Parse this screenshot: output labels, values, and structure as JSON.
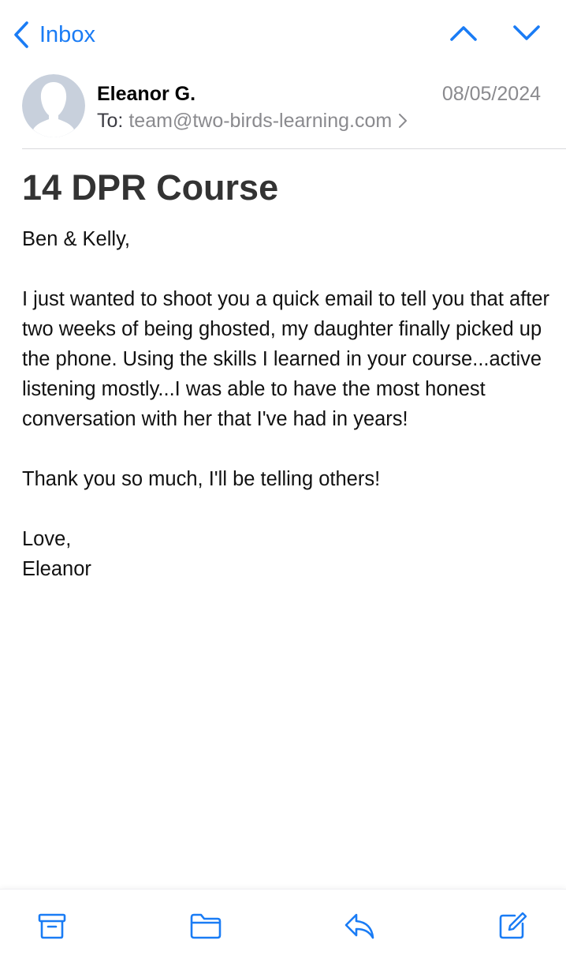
{
  "nav": {
    "back_label": "Inbox",
    "back_icon": "chevron-left-icon",
    "prev_icon": "chevron-up-icon",
    "next_icon": "chevron-down-icon"
  },
  "header": {
    "sender": "Eleanor G.",
    "date": "08/05/2024",
    "to_label": "To:",
    "to_address": "team@two-birds-learning.com",
    "avatar_icon": "person-silhouette-icon"
  },
  "message": {
    "subject": "14 DPR Course",
    "greeting": "Ben & Kelly,",
    "paragraph_1": "I just wanted to shoot you a quick email to tell you that after two weeks of being ghosted, my daughter finally picked up the phone. Using the skills I learned in your course...active listening mostly...I was able to have the most honest conversation with her that I've had in years!",
    "paragraph_2": "Thank you so much, I'll be telling others!",
    "closing": "Love,",
    "signature": "Eleanor"
  },
  "toolbar": {
    "icons": [
      "archive-icon",
      "folder-icon",
      "reply-icon",
      "compose-icon"
    ]
  },
  "colors": {
    "accent": "#1a7cf5",
    "secondary_text": "#8a8a8e",
    "subject_text": "#333333",
    "divider": "#d9d9dc"
  }
}
